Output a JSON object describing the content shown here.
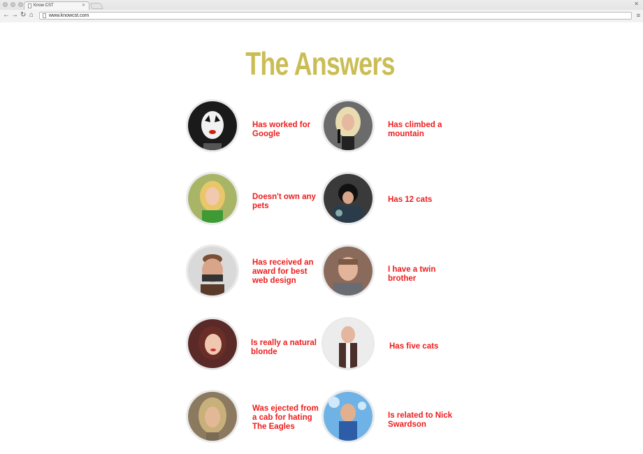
{
  "browser": {
    "tab_title": "Know CST",
    "url": "www.knowcst.com"
  },
  "page": {
    "title": "The Answers"
  },
  "answers": [
    {
      "text": "Has worked for Google"
    },
    {
      "text": "Has climbed a mountain"
    },
    {
      "text": "Doesn't own any pets"
    },
    {
      "text": "Has 12 cats"
    },
    {
      "text": "Has received an award for best web design"
    },
    {
      "text": "I have a twin brother"
    },
    {
      "text": "Is really a natural blonde"
    },
    {
      "text": "Has five cats"
    },
    {
      "text": "Was ejected from a cab for hating The Eagles"
    },
    {
      "text": "Is related to Nick Swardson"
    }
  ],
  "colors": {
    "title": "#cbbd55",
    "answer_text": "#ee1c1c"
  }
}
